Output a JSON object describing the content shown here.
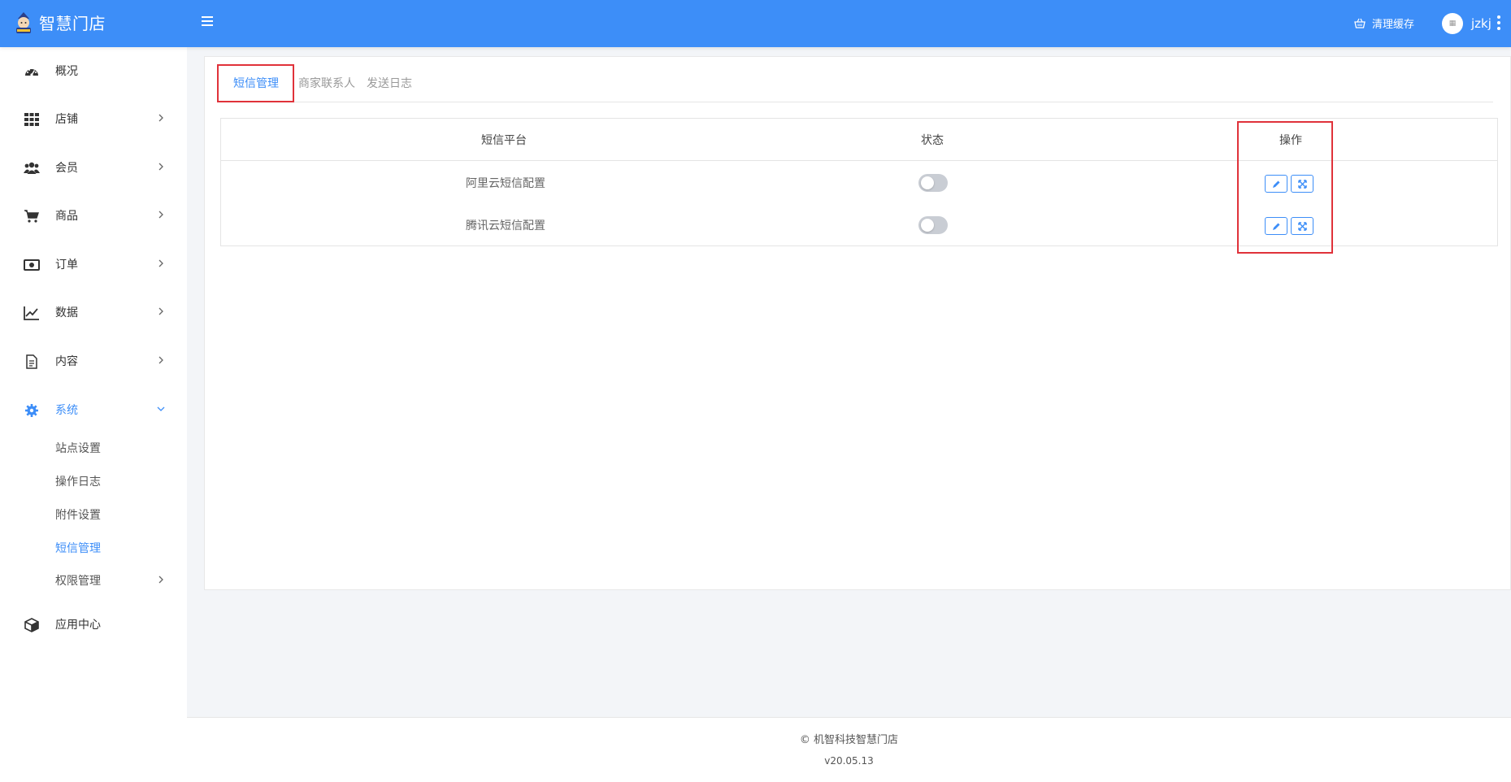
{
  "header": {
    "brand": "智慧门店",
    "clear_cache": "清理缓存",
    "username": "jzkj"
  },
  "sidebar": {
    "items": [
      {
        "label": "概况",
        "icon": "dashboard-icon"
      },
      {
        "label": "店铺",
        "icon": "grid-icon"
      },
      {
        "label": "会员",
        "icon": "users-icon"
      },
      {
        "label": "商品",
        "icon": "cart-icon"
      },
      {
        "label": "订单",
        "icon": "money-icon"
      },
      {
        "label": "数据",
        "icon": "chart-line-icon"
      },
      {
        "label": "内容",
        "icon": "document-icon"
      },
      {
        "label": "系统",
        "icon": "gear-icon"
      },
      {
        "label": "应用中心",
        "icon": "cube-icon"
      }
    ],
    "system_subitems": [
      "站点设置",
      "操作日志",
      "附件设置",
      "短信管理",
      "权限管理"
    ],
    "active_color": "#3d8ef8"
  },
  "tabs": [
    "短信管理",
    "商家联系人",
    "发送日志"
  ],
  "table": {
    "headers": [
      "短信平台",
      "状态",
      "操作"
    ],
    "rows": [
      {
        "platform": "阿里云短信配置",
        "enabled": false
      },
      {
        "platform": "腾讯云短信配置",
        "enabled": false
      }
    ]
  },
  "footer": {
    "copyright": "© 机智科技智慧门店",
    "version": "v20.05.13"
  },
  "colors": {
    "header_bg": "#3d8ef8",
    "highlight": "#e0323a"
  }
}
